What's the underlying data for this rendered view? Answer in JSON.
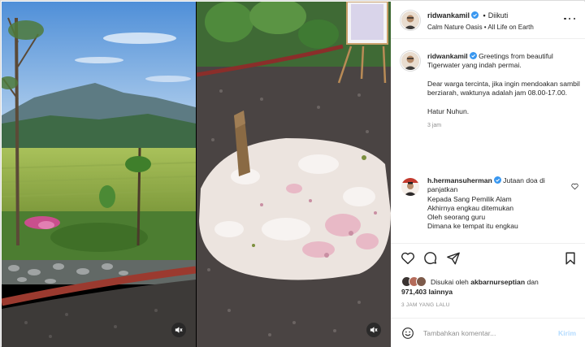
{
  "post": {
    "username": "ridwankamil",
    "follow_separator": "•",
    "follow_status": "Diikuti",
    "location": "Calm Nature Oasis • All Life on Earth"
  },
  "caption": {
    "username": "ridwankamil",
    "text_1": "Greetings from beautiful Tigerwater yang indah permai.",
    "text_2": "Dear warga tercinta, jika ingin mendoakan sambil berziarah, waktunya adalah jam 08.00-17.00.",
    "text_3": "Hatur Nuhun.",
    "time": "3 jam"
  },
  "comment": {
    "username": "h.hermansuherman",
    "first_text": "Jutaan doa di panjatkan",
    "lines": [
      "Kepada Sang Pemilik Alam",
      "Akhirnya engkau ditemukan",
      "Oleh seorang guru",
      "Dimana ke tempat itu engkau"
    ]
  },
  "likes": {
    "prefix": "Disukai oleh",
    "user": "akbarnurseptian",
    "joiner": "dan",
    "count": "971,403 lainnya"
  },
  "posted_ago": "3 JAM YANG LALU",
  "composer": {
    "placeholder": "Tambahkan komentar...",
    "send_label": "Kirim"
  },
  "icons": {
    "more": "more-options-icon",
    "like": "heart-icon",
    "comment": "comment-icon",
    "share": "paper-plane-icon",
    "save": "bookmark-icon",
    "emoji": "smiley-icon",
    "mute": "speaker-muted-icon",
    "verified": "verified-badge-icon"
  },
  "colors": {
    "verified_blue": "#3897f0",
    "send_disabled": "#b3dbff",
    "muted_text": "#8e8e8e"
  }
}
